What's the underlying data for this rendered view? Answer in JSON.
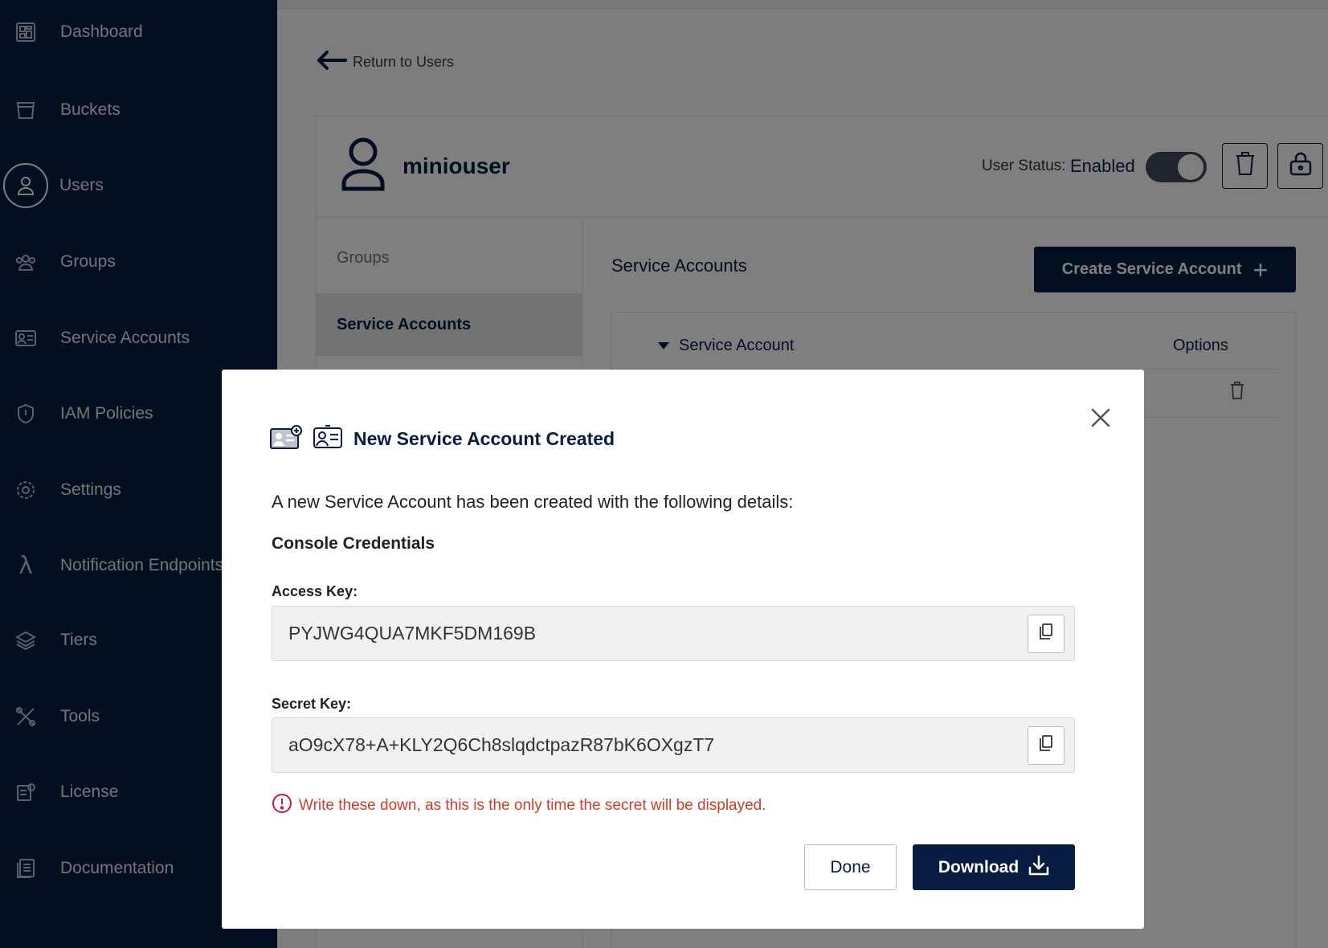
{
  "sidebar": {
    "items": [
      {
        "label": "Dashboard",
        "icon": "dashboard-icon"
      },
      {
        "label": "Buckets",
        "icon": "bucket-icon"
      },
      {
        "label": "Users",
        "icon": "user-icon",
        "active": true
      },
      {
        "label": "Groups",
        "icon": "groups-icon"
      },
      {
        "label": "Service Accounts",
        "icon": "service-account-icon"
      },
      {
        "label": "IAM Policies",
        "icon": "shield-icon"
      },
      {
        "label": "Settings",
        "icon": "gear-icon"
      },
      {
        "label": "Notification Endpoints",
        "icon": "lambda-icon"
      },
      {
        "label": "Tiers",
        "icon": "tiers-icon"
      },
      {
        "label": "Tools",
        "icon": "tools-icon"
      },
      {
        "label": "License",
        "icon": "license-icon"
      },
      {
        "label": "Documentation",
        "icon": "documentation-icon"
      }
    ]
  },
  "main": {
    "back_link": "Return to Users",
    "user": {
      "name": "miniouser",
      "status_label": "User Status:",
      "status_value": "Enabled",
      "enabled": true
    },
    "tabs": [
      {
        "label": "Groups"
      },
      {
        "label": "Service Accounts",
        "active": true
      }
    ],
    "section_title": "Service Accounts",
    "create_button": "Create Service Account",
    "table": {
      "columns": [
        "Service Account",
        "Options"
      ]
    }
  },
  "modal": {
    "title": "New Service Account Created",
    "description": "A new Service Account has been created with the following details:",
    "subtitle": "Console Credentials",
    "access_key_label": "Access Key:",
    "access_key": "PYJWG4QUA7MKF5DM169B",
    "secret_key_label": "Secret Key:",
    "secret_key": "aO9cX78+A+KLY2Q6Ch8slqdctpazR87bK6OXgzT7",
    "warning": "Write these down, as this is the only time the secret will be displayed.",
    "done_button": "Done",
    "download_button": "Download"
  },
  "colors": {
    "sidebar_bg": "#081c42",
    "primary": "#081c42",
    "warning": "#d23b27"
  }
}
